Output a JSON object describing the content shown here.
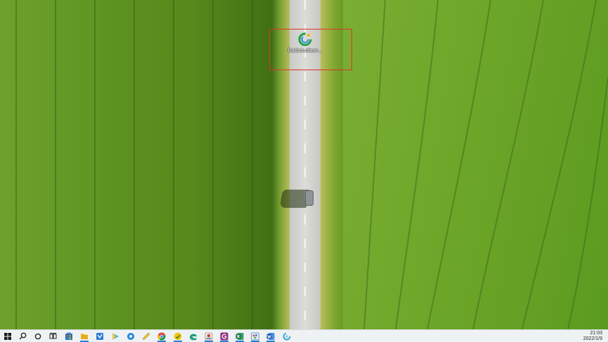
{
  "desktop": {
    "icons": [
      {
        "label": "Baiduoudiaan...",
        "icon": "circular-arrows-app-icon",
        "selected": true
      }
    ]
  },
  "taskbar": {
    "items": [
      {
        "name": "start-button",
        "icon": "windows-logo-icon",
        "running": false
      },
      {
        "name": "search-button",
        "icon": "search-icon",
        "running": false
      },
      {
        "name": "cortana-button",
        "icon": "circle-icon",
        "running": false
      },
      {
        "name": "task-view-button",
        "icon": "task-view-icon",
        "running": false
      },
      {
        "name": "store-app",
        "icon": "store-icon",
        "running": false
      },
      {
        "name": "file-explorer",
        "icon": "folder-icon",
        "running": true
      },
      {
        "name": "mail-app",
        "icon": "mail-icon",
        "running": false
      },
      {
        "name": "media-player-app",
        "icon": "play-icon",
        "running": false
      },
      {
        "name": "settings-app",
        "icon": "gear-icon",
        "running": false
      },
      {
        "name": "pen-tool-app",
        "icon": "pen-icon",
        "running": false
      },
      {
        "name": "chrome-browser",
        "icon": "chrome-icon",
        "running": true
      },
      {
        "name": "yellow-app",
        "icon": "yellow-circle-icon",
        "running": true
      },
      {
        "name": "edge-browser",
        "icon": "edge-icon",
        "running": false
      },
      {
        "name": "photo-app",
        "icon": "photo-icon",
        "running": true
      },
      {
        "name": "purple-app",
        "icon": "purple-g-icon",
        "running": true
      },
      {
        "name": "excel-app",
        "icon": "excel-icon",
        "running": true
      },
      {
        "name": "paint-app",
        "icon": "paint-icon",
        "running": true
      },
      {
        "name": "word-app",
        "icon": "word-icon",
        "running": true
      },
      {
        "name": "sync-app",
        "icon": "circular-arrows-app-icon",
        "running": false
      }
    ],
    "clock": {
      "time": "21:03",
      "date": "2022/1/9"
    }
  },
  "colors": {
    "highlight_border": "#e0332b",
    "taskbar_bg": "#eef2f4",
    "running_indicator": "#2a7fd4"
  }
}
